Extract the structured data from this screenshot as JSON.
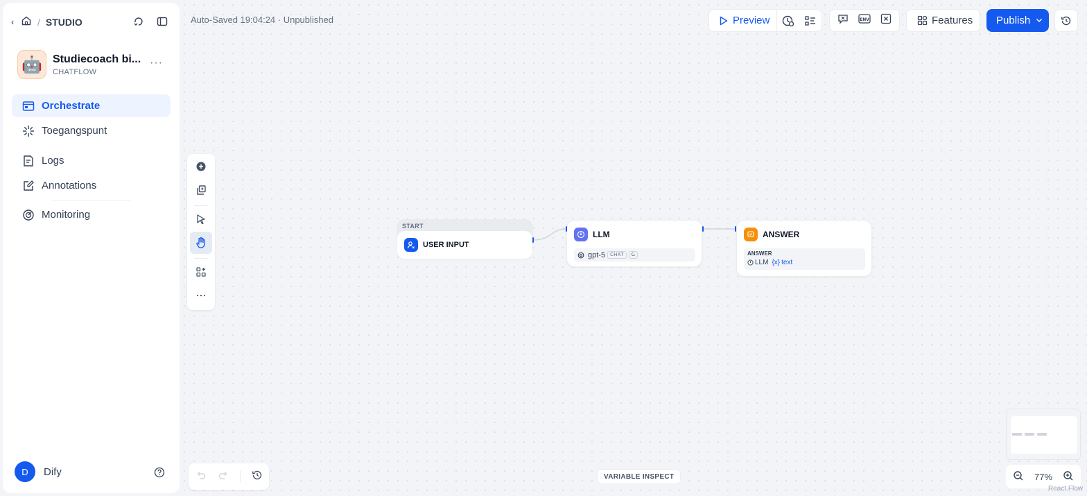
{
  "sidebar": {
    "breadcrumb_label": "STUDIO",
    "app": {
      "name": "Studiecoach bi...",
      "type": "CHATFLOW",
      "avatar_emoji": "🤖"
    },
    "nav_items": [
      {
        "label": "Orchestrate",
        "icon": "workflow-icon",
        "active": true
      },
      {
        "label": "Toegangspunt",
        "icon": "access-point-icon",
        "active": false
      },
      {
        "label": "Logs",
        "icon": "logs-icon",
        "active": false
      },
      {
        "label": "Annotations",
        "icon": "annotations-icon",
        "active": false
      },
      {
        "label": "Monitoring",
        "icon": "monitoring-icon",
        "active": false
      }
    ],
    "user": {
      "initial": "D",
      "name": "Dify"
    }
  },
  "header": {
    "autosave_status": "Auto-Saved 19:04:24 · Unpublished",
    "preview_label": "Preview",
    "features_label": "Features",
    "publish_label": "Publish",
    "accent_color": "#155aef"
  },
  "canvas": {
    "nodes": [
      {
        "group_label": "START",
        "title": "USER INPUT"
      },
      {
        "title": "LLM",
        "model": "gpt-5",
        "model_mode": "CHAT"
      },
      {
        "title": "ANSWER",
        "field_label": "ANSWER",
        "ref_node": "LLM",
        "ref_var": "text"
      }
    ],
    "variable_inspect_label": "VARIABLE INSPECT",
    "zoom": "77%",
    "attribution": "React Flow"
  }
}
